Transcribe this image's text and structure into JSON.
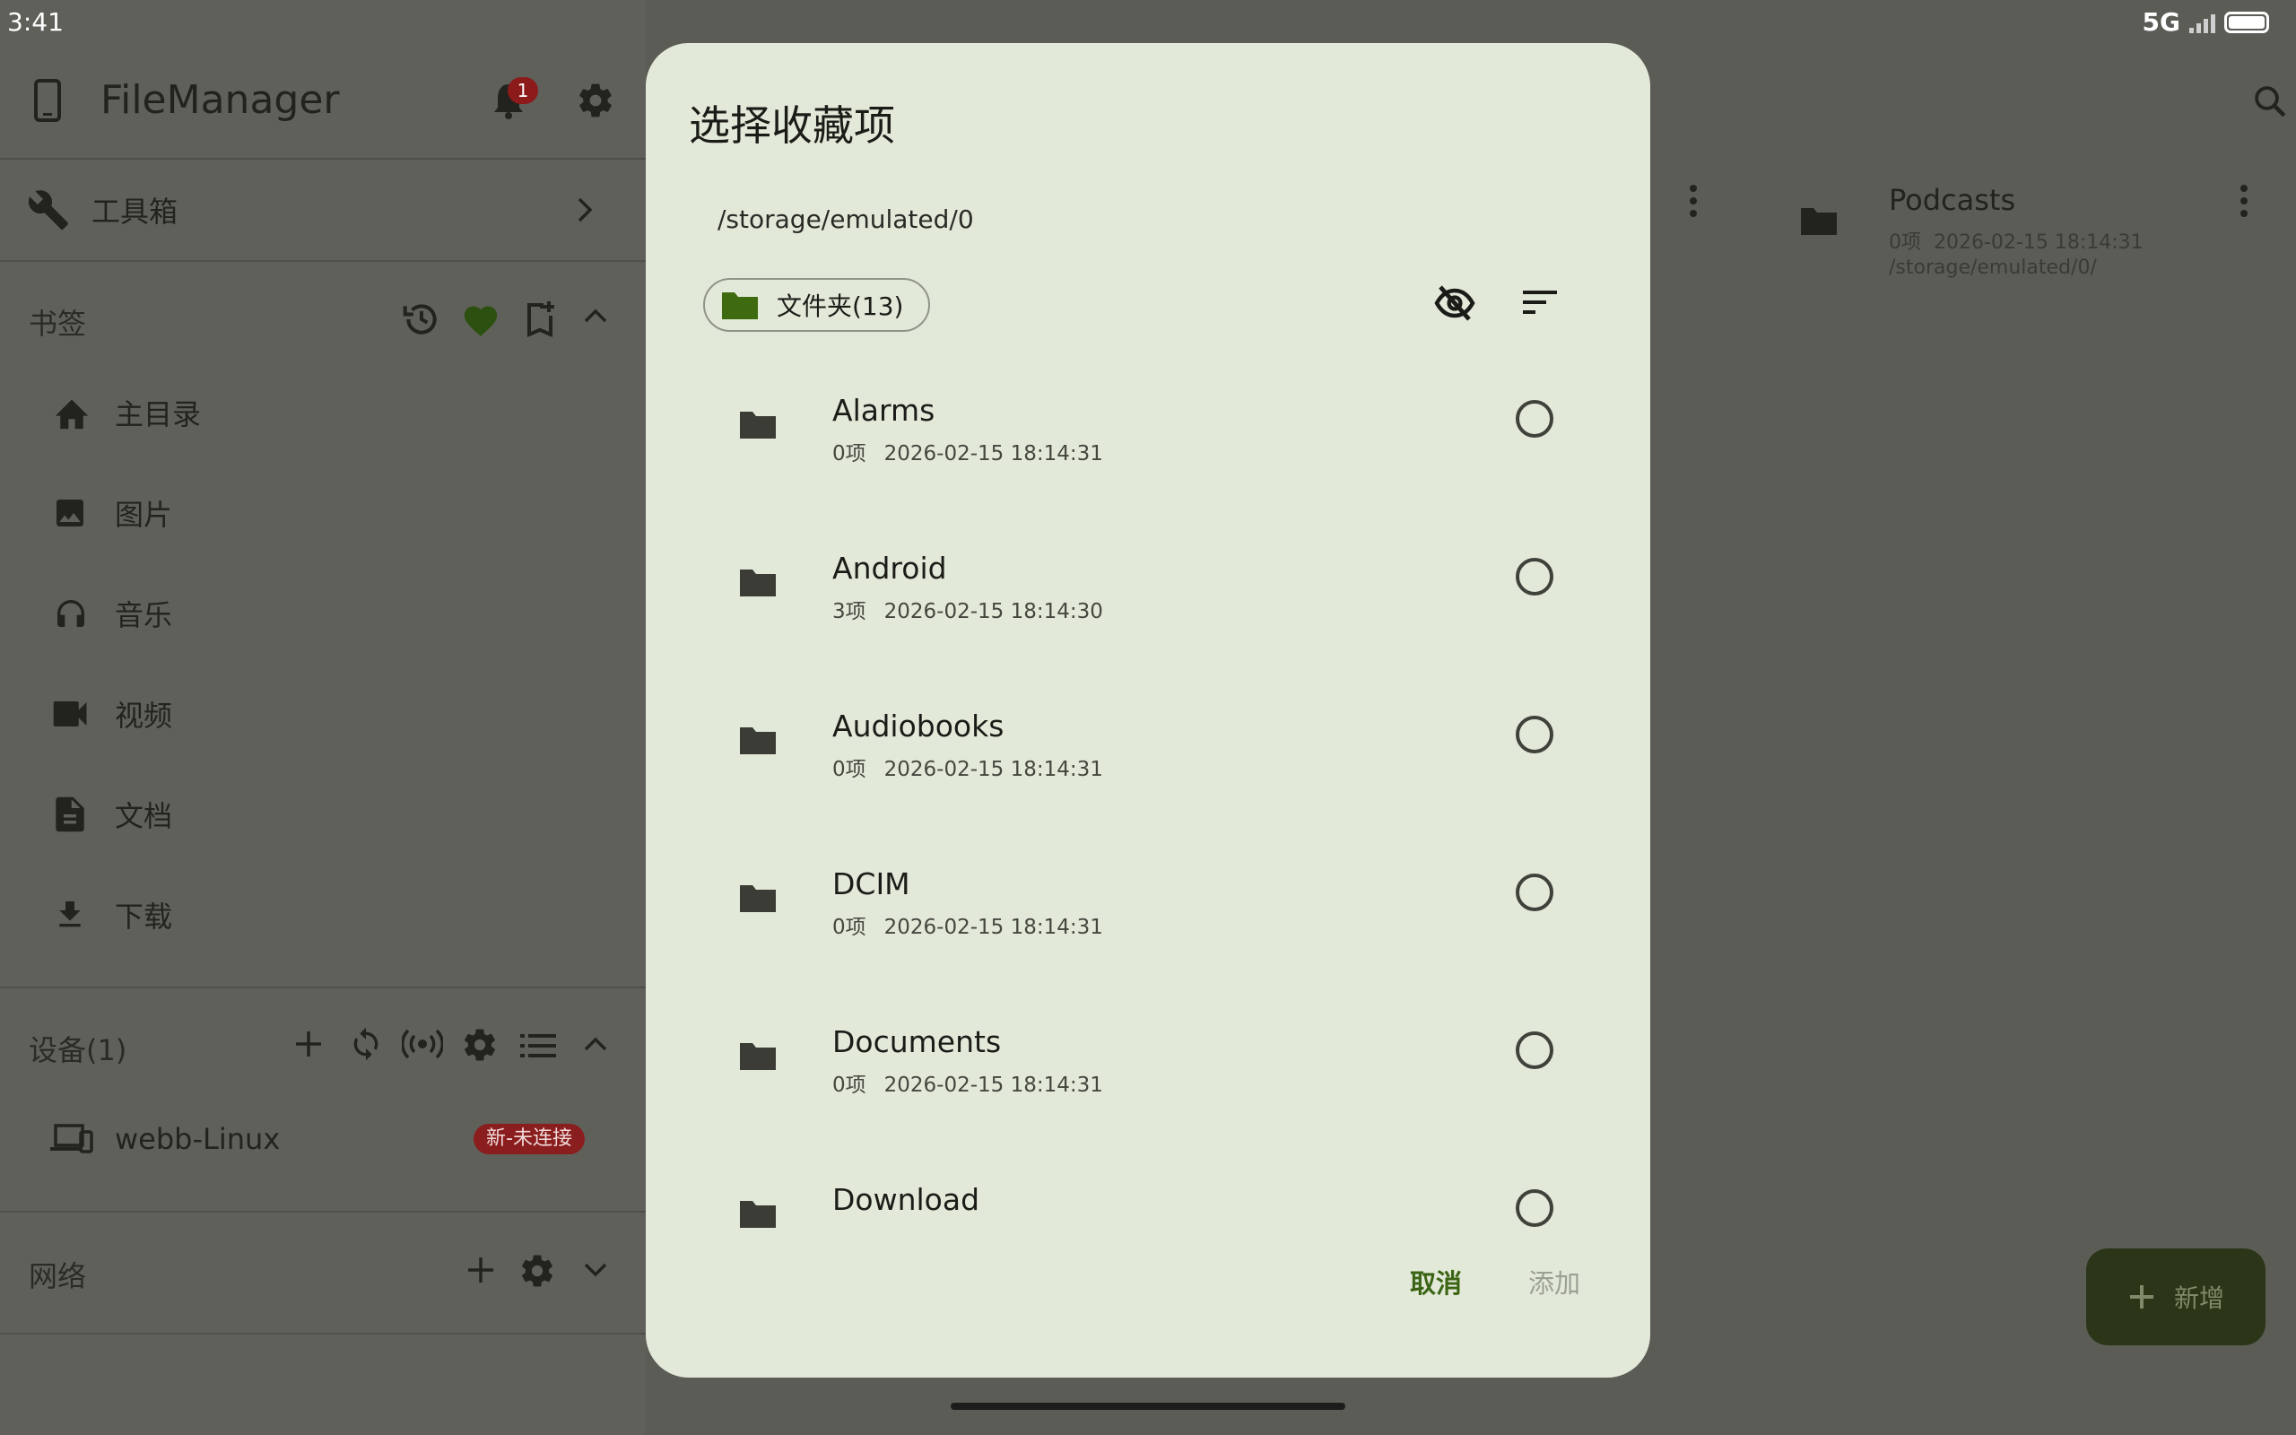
{
  "status": {
    "time": "3:41",
    "network": "5G"
  },
  "app": {
    "title": "FileManager",
    "notification_count": "1"
  },
  "drawer": {
    "toolbox": "工具箱",
    "bookmarks": {
      "header": "书签",
      "items": [
        {
          "label": "主目录",
          "icon": "home-icon"
        },
        {
          "label": "图片",
          "icon": "image-icon"
        },
        {
          "label": "音乐",
          "icon": "headphones-icon"
        },
        {
          "label": "视频",
          "icon": "video-icon"
        },
        {
          "label": "文档",
          "icon": "document-icon"
        },
        {
          "label": "下载",
          "icon": "download-icon"
        }
      ]
    },
    "devices": {
      "header": "设备(1)",
      "device_name": "webb-Linux",
      "device_status": "新-未连接"
    },
    "network": {
      "header": "网络"
    }
  },
  "main": {
    "bg_item": {
      "name": "Podcasts",
      "count": "0项",
      "date": "2026-02-15 18:14:31",
      "path": "/storage/emulated/0/"
    },
    "fab_label": "新增"
  },
  "dialog": {
    "title": "选择收藏项",
    "path": "/storage/emulated/0",
    "chip_label": "文件夹(13)",
    "items": [
      {
        "name": "Alarms",
        "count": "0项",
        "date": "2026-02-15 18:14:31"
      },
      {
        "name": "Android",
        "count": "3项",
        "date": "2026-02-15 18:14:30"
      },
      {
        "name": "Audiobooks",
        "count": "0项",
        "date": "2026-02-15 18:14:31"
      },
      {
        "name": "DCIM",
        "count": "0项",
        "date": "2026-02-15 18:14:31"
      },
      {
        "name": "Documents",
        "count": "0项",
        "date": "2026-02-15 18:14:31"
      },
      {
        "name": "Download",
        "count": "",
        "date": ""
      }
    ],
    "cancel_label": "取消",
    "add_label": "添加"
  },
  "colors": {
    "dialog_bg": "#e3e9d9",
    "accent": "#3b6514",
    "folder_chip": "#3f6b10",
    "scrim": "#5b5c56"
  }
}
